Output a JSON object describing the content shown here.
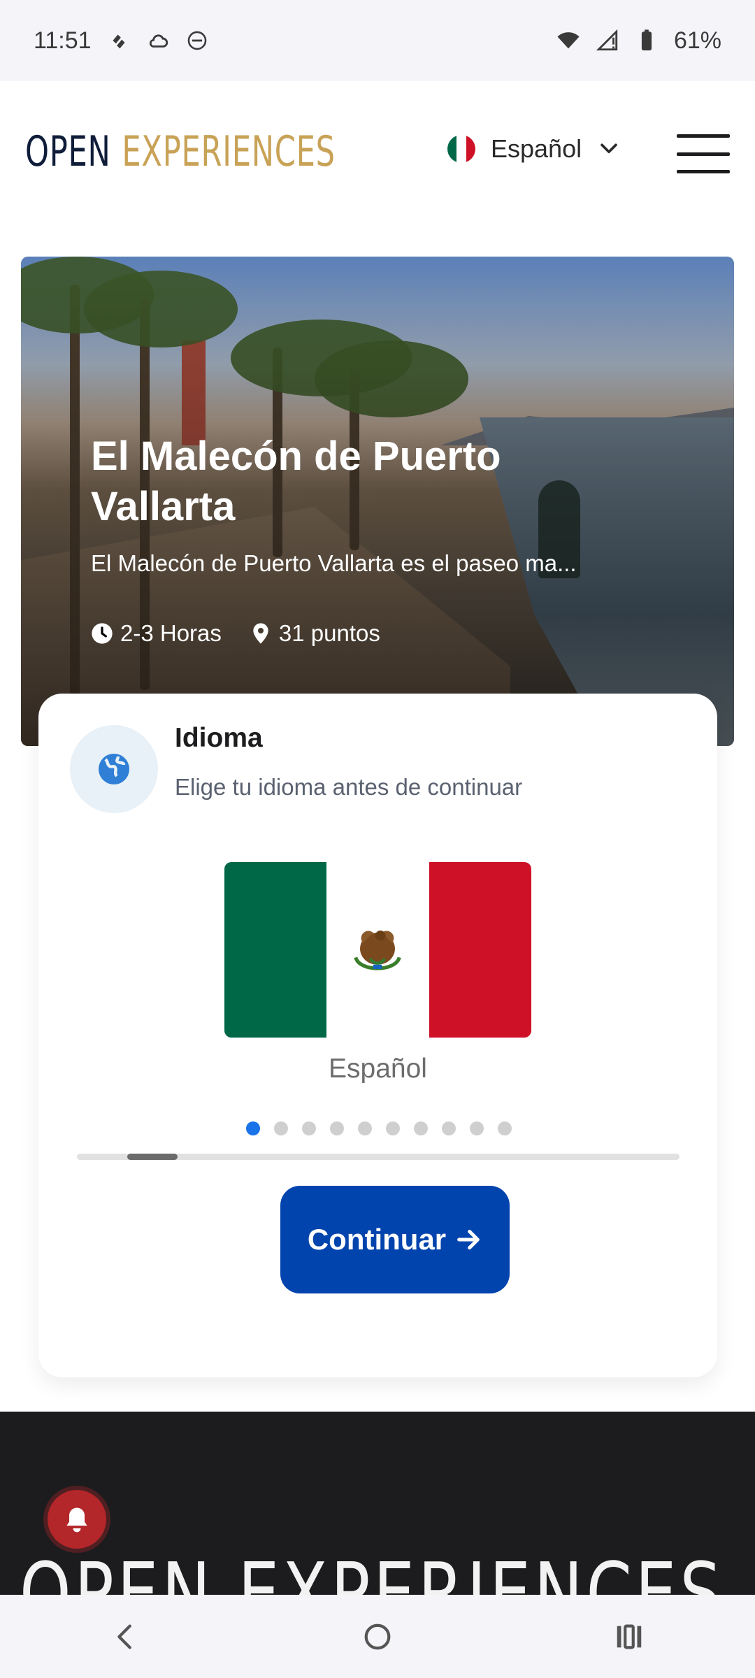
{
  "status_bar": {
    "time": "11:51",
    "battery": "61%",
    "icons": [
      "notification-icon",
      "cloud-icon",
      "circle-icon",
      "wifi-icon",
      "signal-icon",
      "battery-icon"
    ]
  },
  "header": {
    "logo_primary": "OPEN",
    "logo_secondary": "EXPERIENCES",
    "language": "Español",
    "colors": {
      "logo_primary": "#0f1d3a",
      "logo_secondary": "#c8a256"
    }
  },
  "hero": {
    "title": "El Malecón de Puerto Vallarta",
    "description": "El Malecón de Puerto Vallarta es el paseo ma...",
    "duration": "2-3 Horas",
    "points": "31 puntos"
  },
  "language_card": {
    "title": "Idioma",
    "subtitle": "Elige tu idioma antes de continuar",
    "selected_language": "Español",
    "carousel_dots": 10,
    "active_dot": 0,
    "button_label": "Continuar",
    "colors": {
      "button": "#0144ad",
      "active_dot": "#1a73e8"
    }
  },
  "footer": {
    "logo": "OPEN EXPERIENCES"
  }
}
